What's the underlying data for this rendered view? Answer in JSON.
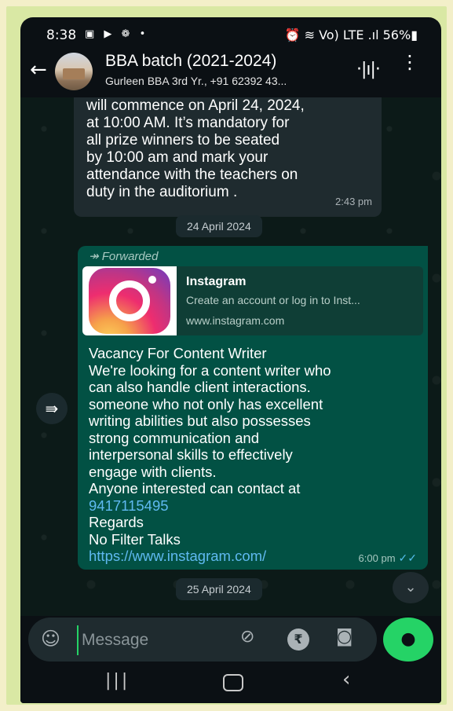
{
  "status_bar": {
    "time": "8:38",
    "left_icons": "▣ ▶ ❁ •",
    "right_text": "⏰ ≋ Vo) LTE .ıl 56%▮"
  },
  "header": {
    "title": "BBA batch (2021-2024)",
    "subtitle": "Gurleen BBA 3rd Yr., +91 62392 43..."
  },
  "messages": {
    "incoming": {
      "lines": [
        "will commence  on April 24, 2024,",
        "at 10:00 AM. It’s mandatory  for",
        "all prize winners to be seated",
        "by 10:00 am and mark your",
        "attendance with the teachers on",
        "duty in the auditorium ."
      ],
      "time": "2:43 pm"
    },
    "date_1": "24 April 2024",
    "outgoing": {
      "forwarded_label": "Forwarded",
      "preview": {
        "title": "Instagram",
        "description": "Create an account or log in to Inst...",
        "url": "www.instagram.com"
      },
      "lines": [
        "Vacancy For Content Writer",
        "We're looking for a content writer who",
        "can also handle client interactions.",
        "someone who not only has excellent",
        "writing abilities but also possesses",
        "strong communication and",
        "interpersonal skills to effectively",
        "engage with clients.",
        "Anyone interested can contact at"
      ],
      "phone": "9417115495",
      "lines_after": [
        "Regards",
        "No Filter Talks"
      ],
      "link": "https://www.instagram.com/",
      "time": "6:00 pm"
    },
    "date_2": "25 April 2024"
  },
  "input": {
    "placeholder": "Message"
  },
  "colors": {
    "outgoing_bubble": "#025144",
    "incoming_bubble": "#1f2b2f",
    "accent_green": "#25d366",
    "link_blue": "#5fb9f0"
  }
}
